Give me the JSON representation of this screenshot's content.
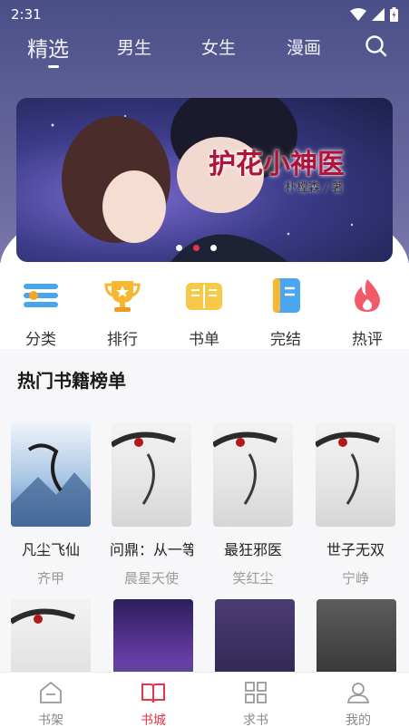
{
  "status": {
    "time": "2:31",
    "icons": [
      "wifi-icon",
      "signal-icon",
      "battery-icon"
    ]
  },
  "tabs": [
    {
      "label": "精选",
      "active": true
    },
    {
      "label": "男生",
      "active": false
    },
    {
      "label": "女生",
      "active": false
    },
    {
      "label": "漫画",
      "active": false
    }
  ],
  "banner": {
    "title": "护花小神医",
    "author": "朴樘森 / 著",
    "dots": 3,
    "active_dot": 1
  },
  "categories": [
    {
      "label": "分类",
      "icon": "list-icon"
    },
    {
      "label": "排行",
      "icon": "trophy-icon"
    },
    {
      "label": "书单",
      "icon": "open-book-icon"
    },
    {
      "label": "完结",
      "icon": "notebook-icon"
    },
    {
      "label": "热评",
      "icon": "flame-icon"
    }
  ],
  "section": {
    "title": "热门书籍榜单"
  },
  "books_row1": [
    {
      "title": "凡尘飞仙",
      "author": "齐甲"
    },
    {
      "title": "问鼎：从一等…",
      "author": "晨星天使"
    },
    {
      "title": "最狂邪医",
      "author": "笑红尘"
    },
    {
      "title": "世子无双",
      "author": "宁峥"
    }
  ],
  "nav": [
    {
      "label": "书架",
      "icon": "bookshelf-icon",
      "active": false
    },
    {
      "label": "书城",
      "icon": "bookstore-icon",
      "active": true
    },
    {
      "label": "求书",
      "icon": "grid-icon",
      "active": false
    },
    {
      "label": "我的",
      "icon": "user-icon",
      "active": false
    }
  ],
  "colors": {
    "accent": "#e8334a",
    "header": "#5e5f96"
  }
}
